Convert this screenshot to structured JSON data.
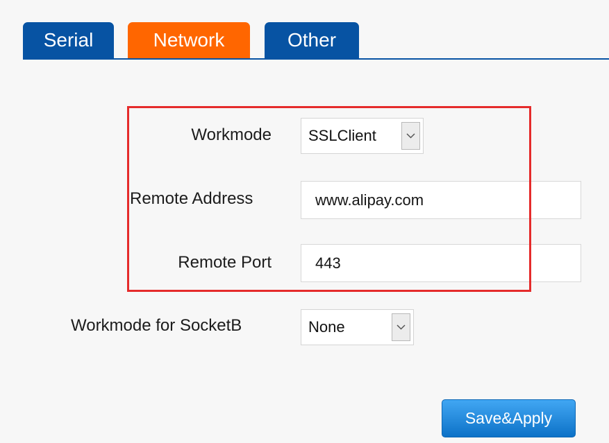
{
  "tabs": [
    {
      "label": "Serial",
      "active": false
    },
    {
      "label": "Network",
      "active": true
    },
    {
      "label": "Other",
      "active": false
    }
  ],
  "form": {
    "workmode": {
      "label": "Workmode",
      "value": "SSLClient"
    },
    "remote_address": {
      "label": "Remote Address",
      "value": "www.alipay.com"
    },
    "remote_port": {
      "label": "Remote Port",
      "value": "443"
    },
    "workmode_socketb": {
      "label": "Workmode for SocketB",
      "value": "None"
    }
  },
  "actions": {
    "save_apply": "Save&Apply"
  },
  "colors": {
    "tab_blue": "#0753a3",
    "tab_active_orange": "#ff6600",
    "highlight_red": "#e52b2b",
    "button_blue": "#1886dc"
  },
  "icons": {
    "dropdown": "chevron-down-icon"
  }
}
